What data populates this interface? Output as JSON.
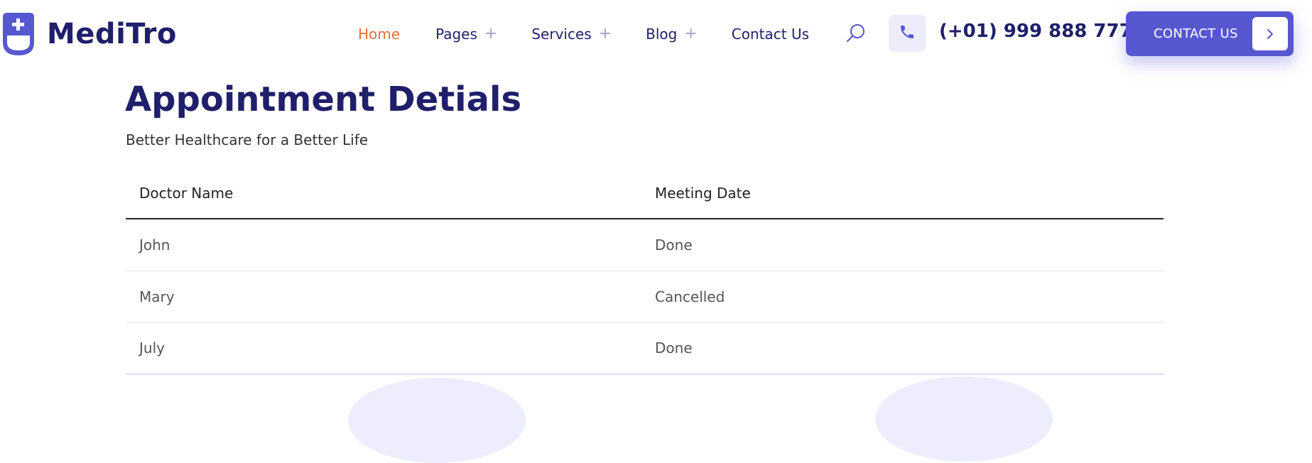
{
  "brand": {
    "name": "MediTro",
    "accent_color": "#5758d0",
    "dark_color": "#1f1f6b",
    "active_color": "#e2703a"
  },
  "nav": {
    "items": [
      {
        "label": "Home",
        "active": true,
        "has_submenu": false
      },
      {
        "label": "Pages",
        "active": false,
        "has_submenu": true
      },
      {
        "label": "Services",
        "active": false,
        "has_submenu": true
      },
      {
        "label": "Blog",
        "active": false,
        "has_submenu": true
      },
      {
        "label": "Contact Us",
        "active": false,
        "has_submenu": false
      }
    ],
    "submenu_glyph": "+"
  },
  "header": {
    "search_icon": "search-icon",
    "phone_icon": "phone-icon",
    "phone_number": "(+01) 999 888 777",
    "cta_label": "CONTACT US",
    "cta_icon": "chevron-right-icon"
  },
  "page": {
    "title": "Appointment Detials",
    "subtitle": "Better Healthcare for a Better Life"
  },
  "table": {
    "headers": [
      "Doctor Name",
      "Meeting Date"
    ],
    "rows": [
      [
        "John",
        "Done"
      ],
      [
        "Mary",
        "Cancelled"
      ],
      [
        "July",
        "Done"
      ]
    ]
  }
}
